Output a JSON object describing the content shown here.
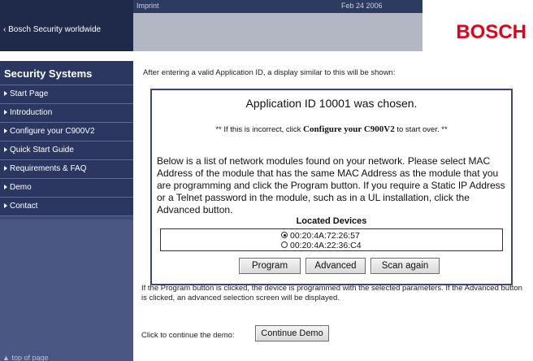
{
  "topbar": {
    "imprint": "Imprint",
    "date": "Feb 24 2006"
  },
  "header": {
    "worldwide_link": "Bosch Security worldwide",
    "logo": "BOSCH",
    "brand_color": "#e2001a"
  },
  "sidebar": {
    "title": "Security Systems",
    "items": [
      {
        "label": "Start Page"
      },
      {
        "label": "Introduction"
      },
      {
        "label": "Configure your C900V2"
      },
      {
        "label": "Quick Start Guide"
      },
      {
        "label": "Requirements & FAQ"
      },
      {
        "label": "Demo"
      },
      {
        "label": "Contact"
      }
    ],
    "top_of_page": "top of page"
  },
  "main": {
    "intro": "After entering a valid Application ID, a display similar to this will be shown:",
    "panel": {
      "title": "Application ID 10001 was chosen.",
      "warning_prefix": "** If this is incorrect, click ",
      "warning_link": "Configure your C900V2",
      "warning_suffix": " to start over. **",
      "description": "Below is a list of network modules found on your network.  Please select MAC Address of the module that has the same MAC Address as the module that you are programming and click the Program button.  If you require a Static IP Address or a Telnet password in the module, such as in a UL installation, click the Advanced button.",
      "located_devices_label": "Located Devices",
      "devices": [
        {
          "mac": "00:20:4A:72:26:57",
          "selected": true
        },
        {
          "mac": "00:20:4A:22:36:C4",
          "selected": false
        }
      ],
      "buttons": {
        "program": "Program",
        "advanced": "Advanced",
        "scan": "Scan again"
      }
    },
    "note": "If the Program button is clicked, the device is programmed with the selected parameters.  If the Advanced button is clicked, an advanced selection screen will be displayed.",
    "continue_label": "Click to continue the demo:",
    "continue_button": "Continue Demo"
  }
}
